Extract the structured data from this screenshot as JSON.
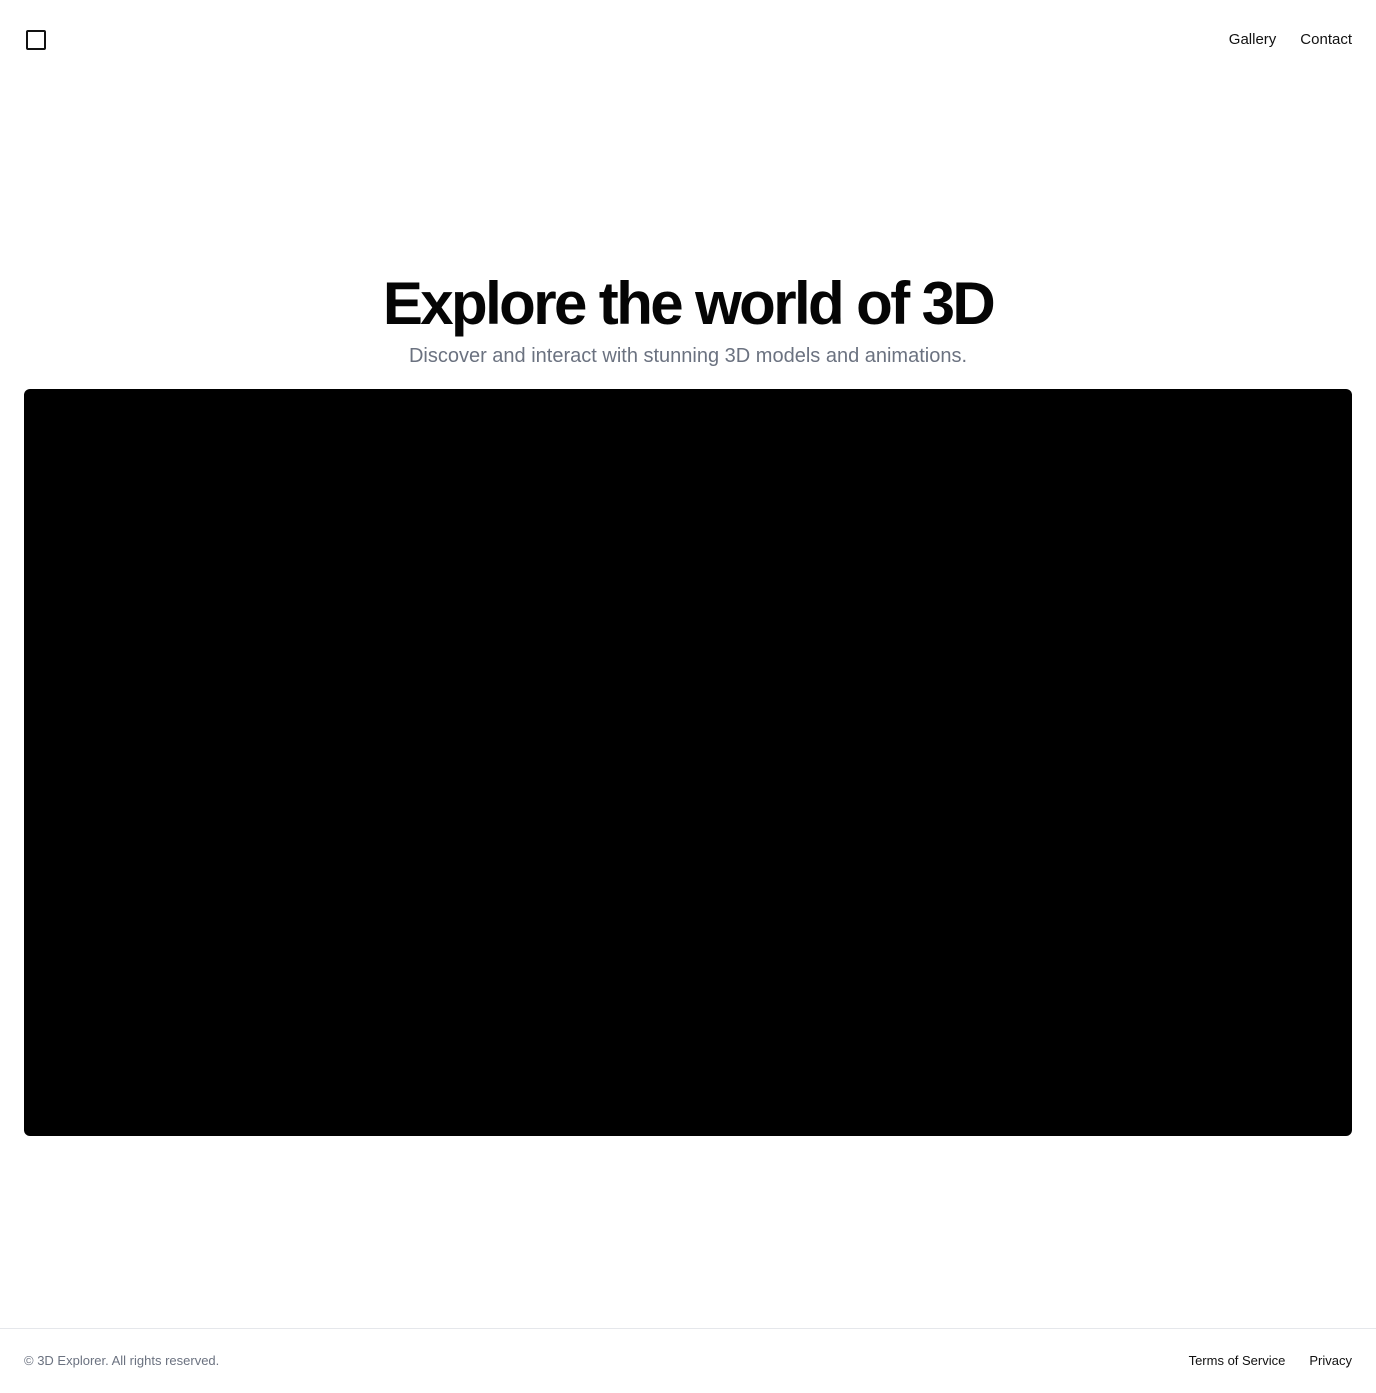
{
  "header": {
    "logo_icon": "square-outline-icon",
    "nav": [
      {
        "label": "Gallery"
      },
      {
        "label": "Contact"
      }
    ]
  },
  "hero": {
    "title": "Explore the world of 3D",
    "subtitle": "Discover and interact with stunning 3D models and animations."
  },
  "viewer": {
    "background_color": "#000000"
  },
  "footer": {
    "copyright": "© 3D Explorer. All rights reserved.",
    "links": [
      {
        "label": "Terms of Service"
      },
      {
        "label": "Privacy"
      }
    ]
  },
  "colors": {
    "text": "#050505",
    "muted": "#6b7280",
    "border": "#e5e7eb",
    "background": "#ffffff"
  }
}
